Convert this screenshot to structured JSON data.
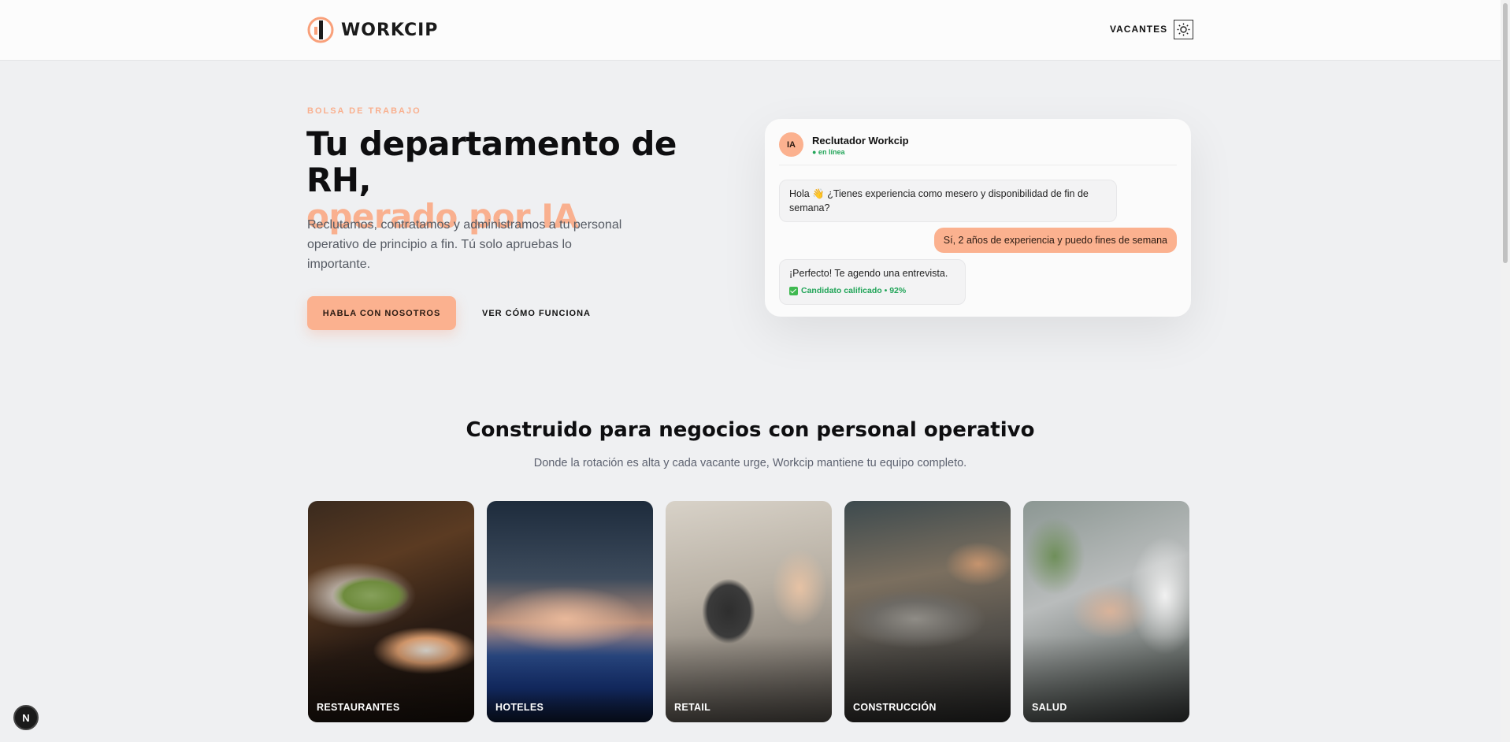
{
  "header": {
    "brand": "WORKCIP",
    "nav_vacantes": "VACANTES",
    "theme_icon": "sun-icon"
  },
  "hero": {
    "eyebrow": "BOLSA DE TRABAJO",
    "title_line1": "Tu departamento de RH,",
    "title_line2": "operado por IA",
    "description": "Reclutamos, contratamos y administramos a tu personal operativo de principio a fin. Tú solo apruebas lo importante.",
    "cta_primary": "HABLA CON NOSOTROS",
    "cta_secondary": "VER CÓMO FUNCIONA"
  },
  "chat": {
    "avatar": "IA",
    "name": "Reclutador Workcip",
    "status": "● en línea",
    "messages": [
      {
        "from": "bot",
        "text": "Hola 👋 ¿Tienes experiencia como mesero y disponibilidad de fin de semana?"
      },
      {
        "from": "user",
        "text": "Sí, 2 años de experiencia y puedo fines de semana"
      },
      {
        "from": "bot",
        "text": "¡Perfecto! Te agendo una entrevista."
      }
    ],
    "qualified": "Candidato calificado • 92%"
  },
  "industries": {
    "title": "Construido para negocios con personal operativo",
    "subtitle": "Donde la rotación es alta y cada vacante urge, Workcip mantiene tu equipo completo.",
    "cards": [
      {
        "label": "RESTAURANTES"
      },
      {
        "label": "HOTELES"
      },
      {
        "label": "RETAIL"
      },
      {
        "label": "CONSTRUCCIÓN"
      },
      {
        "label": "SALUD"
      }
    ]
  },
  "dev_badge": "N",
  "colors": {
    "accent": "#f9b08f",
    "online": "#22a559",
    "background": "#eff0f2"
  }
}
